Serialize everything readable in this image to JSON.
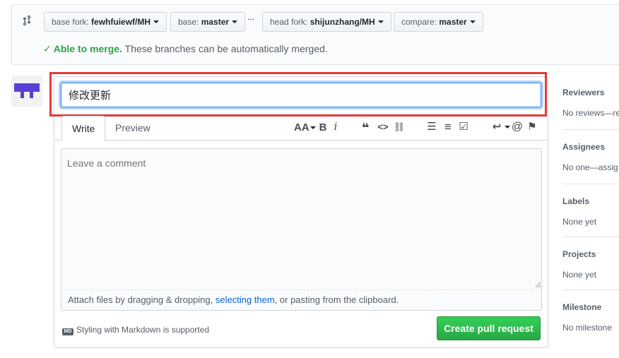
{
  "compare": {
    "base_fork": {
      "prefix": "base fork: ",
      "value": "fewhfuiewf/MH"
    },
    "base": {
      "prefix": "base: ",
      "value": "master"
    },
    "ellipsis": "...",
    "head_fork": {
      "prefix": "head fork: ",
      "value": "shijunzhang/MH"
    },
    "compare": {
      "prefix": "compare: ",
      "value": "master"
    },
    "status_strong": "Able to merge.",
    "status_rest": " These branches can be automatically merged."
  },
  "form": {
    "title_value": "修改更新",
    "tabs": {
      "write": "Write",
      "preview": "Preview"
    },
    "toolbar": {
      "heading": "AA",
      "bold": "B",
      "italic": "i",
      "quote": "❝",
      "code": "<>",
      "link": "⛓",
      "ul": "☰",
      "ol": "≡",
      "tasklist": "☑",
      "reply": "↩",
      "mention": "@",
      "bookmark": "⚑"
    },
    "comment_placeholder": "Leave a comment",
    "attach_prefix": "Attach files by dragging & dropping, ",
    "attach_link": "selecting them",
    "attach_suffix": ", or pasting from the clipboard.",
    "markdown_badge": "MD",
    "markdown_note": "Styling with Markdown is supported",
    "submit_label": "Create pull request"
  },
  "sidebar": {
    "reviewers": {
      "label": "Reviewers",
      "value": "No reviews—re"
    },
    "assignees": {
      "label": "Assignees",
      "value": "No one—assig"
    },
    "labels": {
      "label": "Labels",
      "value": "None yet"
    },
    "projects": {
      "label": "Projects",
      "value": "None yet"
    },
    "milestone": {
      "label": "Milestone",
      "value": "No milestone"
    }
  },
  "colors": {
    "accent_green": "#28a745",
    "link_blue": "#0366d6",
    "highlight_red": "#e03b3b",
    "avatar_purple": "#5a3fd6"
  }
}
